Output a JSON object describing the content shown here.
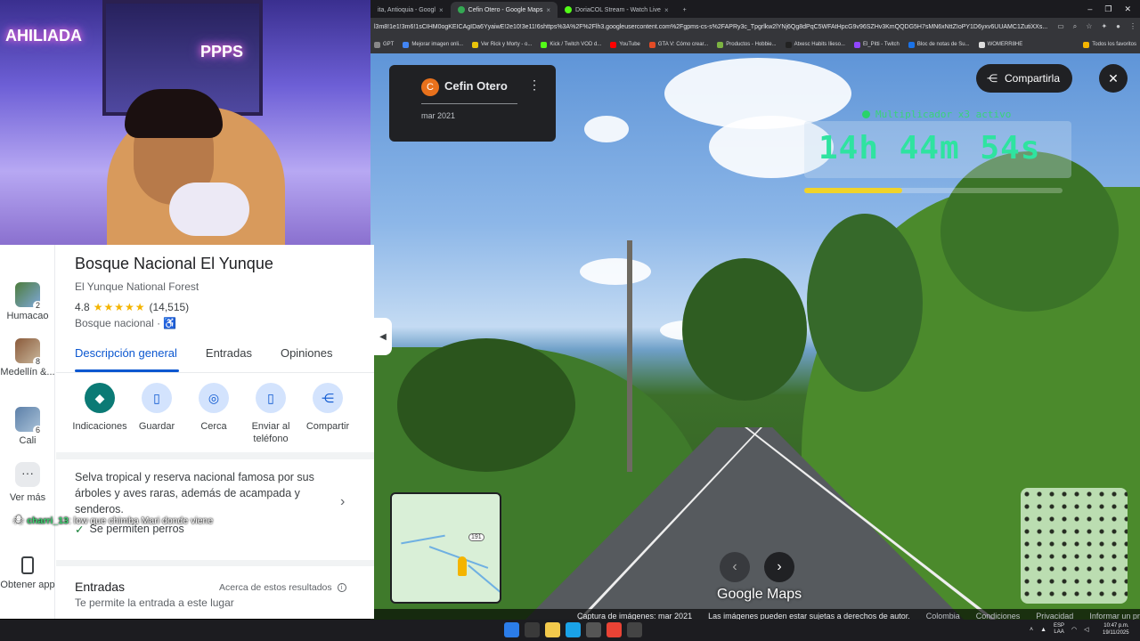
{
  "browser": {
    "tabs": [
      {
        "label": "ita, Antioquia - Googl",
        "active": false
      },
      {
        "label": "Cefin Otero - Google Maps",
        "active": true
      },
      {
        "label": "DoriaCOL Stream - Watch Live",
        "active": false
      }
    ],
    "url": "l3m8!1e1!3m6!1sCIHM0ogKEICAgIDa6YyaiwE!2e10!3e11!6shttps%3A%2F%2Flh3.googleusercontent.com%2Fgpms-cs-s%2FAPRy3c_Tpgrlkw2lYNj6Qg8dPqC5WFAtHpcG9v96SZHv3KmQQDG5H7sMN6xNttZIoPY1D6yxv6UUAMC1ZutiXXs...",
    "bookmarks": [
      "GPT",
      "Mejorar imagen onli...",
      "Ver Rick y Morty - o...",
      "Kick / Twitch VOD d...",
      "YouTube",
      "GTA V: Cómo crear...",
      "Productos - Hobbie...",
      "Atxesc Habits Ilieso...",
      "El_Pitti - Twitch",
      "Bloc de notas de Su...",
      "WOMERR8HE"
    ],
    "all_bookmarks": "Todos los favoritos"
  },
  "streetview": {
    "author": "Cefin Otero",
    "author_initial": "C",
    "date": "mar 2021",
    "share_label": "Compartirla",
    "timer_status": "Multiplicador x3 activo",
    "timer": "14h 44m 54s",
    "timer_progress": 0.38,
    "minimap_route": "191",
    "logo": "Google Maps",
    "footer": {
      "capture": "Captura de imágenes: mar 2021",
      "rights": "Las imágenes pueden estar sujetas a derechos de autor.",
      "country": "Colombia",
      "terms": "Condiciones",
      "privacy": "Privacidad",
      "report": "Informar un problema"
    }
  },
  "rail": {
    "items": [
      {
        "label": "Humacao",
        "count": "2"
      },
      {
        "label": "Medellín &...",
        "count": "8"
      },
      {
        "label": "Cali",
        "count": "6"
      }
    ],
    "more": "Ver más",
    "get_app": "Obtener app"
  },
  "place": {
    "title": "Bosque Nacional El Yunque",
    "subtitle": "El Yunque National Forest",
    "rating": "4.8",
    "stars": "★★★★★",
    "reviews": "(14,515)",
    "type": "Bosque nacional · ♿",
    "tabs": [
      "Descripción general",
      "Entradas",
      "Opiniones"
    ],
    "actions": [
      "Indicaciones",
      "Guardar",
      "Cerca",
      "Enviar al teléfono",
      "Compartir"
    ],
    "description": "Selva tropical y reserva nacional famosa por sus árboles y aves raras, además de acampada y senderos.",
    "perk": "Se permiten perros",
    "entries_title": "Entradas",
    "entries_note": "Acerca de estos resultados",
    "entries_sub": "Te permite la entrada a este lugar"
  },
  "chat": {
    "user": "charri_13",
    "message": ": low que chimba Mari donde viene"
  },
  "webcam": {
    "signs": [
      "AHILIADA",
      "PPPS"
    ]
  },
  "taskbar": {
    "lang": "ESP",
    "lang2": "LAA",
    "time": "10:47 p.m.",
    "date": "19/11/2025"
  }
}
